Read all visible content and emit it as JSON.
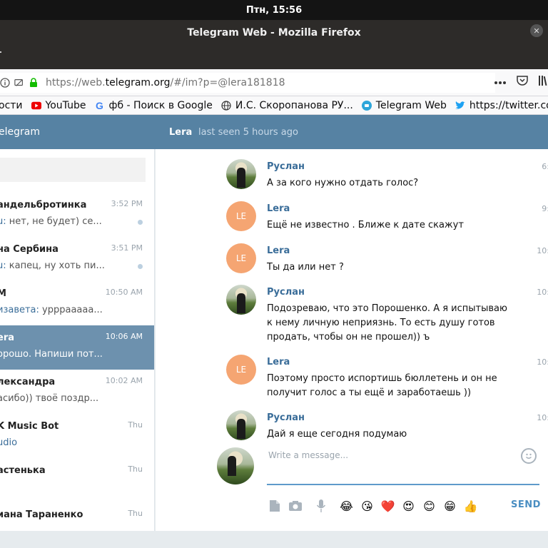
{
  "os": {
    "clock": "Птн, 15:56"
  },
  "window": {
    "title": "Telegram Web - Mozilla Firefox",
    "close_glyph": "✕"
  },
  "urlbar": {
    "url_prefix": "https://web.",
    "url_domain": "telegram.org",
    "url_path": "/#/im?p=@lera181818",
    "icons": [
      "info-icon",
      "permissions-icon",
      "lock-icon",
      "more-icon",
      "pocket-icon",
      "library-icon"
    ]
  },
  "bookmarks": [
    {
      "label": "ости",
      "icon": ""
    },
    {
      "label": "YouTube",
      "icon": "youtube-icon"
    },
    {
      "label": "фб - Поиск в Google",
      "icon": "google-icon"
    },
    {
      "label": "И.С. Скоропанова РУ...",
      "icon": "globe-icon"
    },
    {
      "label": "Telegram Web",
      "icon": "telegram-icon"
    },
    {
      "label": "https://twitter.com",
      "icon": "twitter-icon"
    }
  ],
  "header": {
    "brand": "elegram",
    "peer_name": "Lera",
    "peer_status": "last seen 5 hours ago"
  },
  "dialogs": [
    {
      "name": "андельбротинка",
      "time": "3:52 PM",
      "author": "u:",
      "preview": "нет, не будет) се...",
      "unread_dot": true
    },
    {
      "name": "на Сербина",
      "time": "3:51 PM",
      "author": "u:",
      "preview": "капец, ну хоть пи...",
      "unread_dot": true
    },
    {
      "name": "M",
      "time": "10:50 AM",
      "author": "изавета:",
      "preview": "урррааааа...",
      "unread_dot": false
    },
    {
      "name": "era",
      "time": "10:06 AM",
      "author": "",
      "preview": "орошо. Напиши пот...",
      "unread_dot": false,
      "active": true
    },
    {
      "name": "лександра",
      "time": "10:02 AM",
      "author": "",
      "preview": "асибо)) твоё поздр...",
      "unread_dot": false
    },
    {
      "name": "K Music Bot",
      "time": "Thu",
      "author": "udio",
      "preview": "",
      "unread_dot": false
    },
    {
      "name": "астенька",
      "time": "Thu",
      "author": "",
      "preview": "",
      "unread_dot": false
    },
    {
      "name": "иана Тараненко",
      "time": "Thu",
      "author": "",
      "preview": "",
      "unread_dot": false
    }
  ],
  "messages": [
    {
      "author": "Руслан",
      "avatar": "photo",
      "time": "6:",
      "text": "А за кого нужно отдать голос?"
    },
    {
      "author": "Lera",
      "avatar": "LE",
      "time": "9:",
      "text": "Ещё не известно . Ближе к дате скажут"
    },
    {
      "author": "Lera",
      "avatar": "LE",
      "time": "10:",
      "text": "Ты да или нет ?"
    },
    {
      "author": "Руслан",
      "avatar": "photo",
      "time": "10:",
      "text": "Подозреваю, что это Порошенко. А я испытываю к нему личную неприязнь. То есть душу готов продать, чтобы он не прошел)) ъ"
    },
    {
      "author": "Lera",
      "avatar": "LE",
      "time": "10:",
      "text": "Поэтому просто испортишь бюллетень и он не получит голос а ты ещё и заработаешь ))"
    },
    {
      "author": "Руслан",
      "avatar": "photo",
      "time": "10:",
      "text": "Дай я еще сегодня подумаю"
    }
  ],
  "composer": {
    "placeholder": "Write a message...",
    "send_label": "SEND",
    "tools": [
      "file-icon",
      "camera-icon",
      "microphone-icon"
    ],
    "emojis": [
      "😂",
      "😘",
      "❤️",
      "😍",
      "😊",
      "😁",
      "👍"
    ]
  }
}
